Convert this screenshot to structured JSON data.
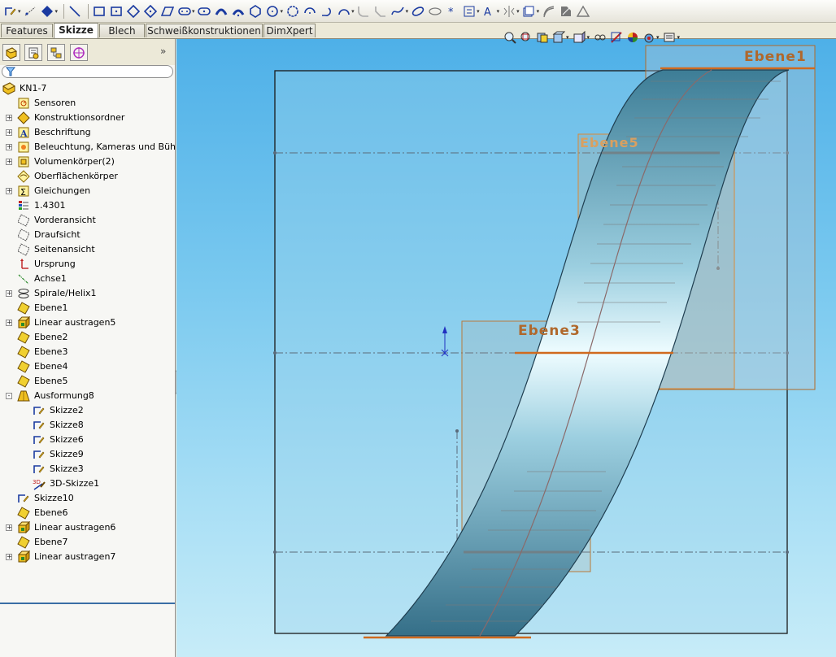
{
  "toolbar": {
    "icons": [
      "sketch-icon",
      "smart-dimension-icon",
      "relations-icon",
      "line-icon",
      "rectangle-icon",
      "center-rectangle-icon",
      "3point-rectangle-icon",
      "3point-center-rectangle-icon",
      "parallelogram-icon",
      "slot-icon",
      "centerpoint-slot-icon",
      "3point-arc-slot-icon",
      "centerpoint-arc-slot-icon",
      "polygon-icon",
      "circle-icon",
      "perimeter-circle-icon",
      "centerpoint-arc-icon",
      "tangent-arc-icon",
      "3point-arc-icon",
      "fillet-icon",
      "chamfer-icon",
      "spline-icon",
      "ellipse-icon",
      "partial-ellipse-icon",
      "point-icon",
      "text-icon",
      "trim-icon",
      "mirror-icon",
      "offset-icon",
      "linear-pattern-icon",
      "move-icon",
      "convert-entities-icon"
    ]
  },
  "tabs": [
    {
      "label": "Features",
      "active": false
    },
    {
      "label": "Skizze",
      "active": true
    },
    {
      "label": "Blech",
      "active": false
    },
    {
      "label": "Schweißkonstruktionen",
      "active": false
    },
    {
      "label": "DimXpert",
      "active": false
    }
  ],
  "panel": {
    "tabs": [
      "feature-manager-icon",
      "property-manager-icon",
      "configuration-manager-icon",
      "dimxpert-manager-icon"
    ],
    "collapse_label": "»",
    "tree": [
      {
        "label": "KN1-7",
        "icon": "part-icon",
        "indent": 0,
        "expander": ""
      },
      {
        "label": "Sensoren",
        "icon": "sensor-icon",
        "indent": 1,
        "expander": ""
      },
      {
        "label": "Konstruktionsordner",
        "icon": "design-binder-icon",
        "indent": 1,
        "expander": "+"
      },
      {
        "label": "Beschriftung",
        "icon": "annotation-icon",
        "indent": 1,
        "expander": "+"
      },
      {
        "label": "Beleuchtung, Kameras und Bühne",
        "icon": "lights-icon",
        "indent": 1,
        "expander": "+"
      },
      {
        "label": "Volumenkörper(2)",
        "icon": "solid-bodies-icon",
        "indent": 1,
        "expander": "+"
      },
      {
        "label": "Oberflächenkörper",
        "icon": "surface-bodies-icon",
        "indent": 1,
        "expander": ""
      },
      {
        "label": "Gleichungen",
        "icon": "equations-icon",
        "indent": 1,
        "expander": "+"
      },
      {
        "label": "1.4301",
        "icon": "material-icon",
        "indent": 1,
        "expander": ""
      },
      {
        "label": "Vorderansicht",
        "icon": "plane-icon",
        "indent": 1,
        "expander": ""
      },
      {
        "label": "Draufsicht",
        "icon": "plane-icon",
        "indent": 1,
        "expander": ""
      },
      {
        "label": "Seitenansicht",
        "icon": "plane-icon",
        "indent": 1,
        "expander": ""
      },
      {
        "label": "Ursprung",
        "icon": "origin-icon",
        "indent": 1,
        "expander": ""
      },
      {
        "label": "Achse1",
        "icon": "axis-icon",
        "indent": 1,
        "expander": ""
      },
      {
        "label": "Spirale/Helix1",
        "icon": "helix-icon",
        "indent": 1,
        "expander": "+"
      },
      {
        "label": "Ebene1",
        "icon": "plane-yellow-icon",
        "indent": 1,
        "expander": ""
      },
      {
        "label": "Linear austragen5",
        "icon": "extrude-icon",
        "indent": 1,
        "expander": "+"
      },
      {
        "label": "Ebene2",
        "icon": "plane-yellow-icon",
        "indent": 1,
        "expander": ""
      },
      {
        "label": "Ebene3",
        "icon": "plane-yellow-icon",
        "indent": 1,
        "expander": ""
      },
      {
        "label": "Ebene4",
        "icon": "plane-yellow-icon",
        "indent": 1,
        "expander": ""
      },
      {
        "label": "Ebene5",
        "icon": "plane-yellow-icon",
        "indent": 1,
        "expander": ""
      },
      {
        "label": "Ausformung8",
        "icon": "loft-icon",
        "indent": 1,
        "expander": "-"
      },
      {
        "label": "Skizze2",
        "icon": "sketch-icon",
        "indent": 2,
        "expander": ""
      },
      {
        "label": "Skizze8",
        "icon": "sketch-icon",
        "indent": 2,
        "expander": ""
      },
      {
        "label": "Skizze6",
        "icon": "sketch-icon",
        "indent": 2,
        "expander": ""
      },
      {
        "label": "Skizze9",
        "icon": "sketch-icon",
        "indent": 2,
        "expander": ""
      },
      {
        "label": "Skizze3",
        "icon": "sketch-icon",
        "indent": 2,
        "expander": ""
      },
      {
        "label": "3D-Skizze1",
        "icon": "3d-sketch-icon",
        "indent": 2,
        "expander": ""
      },
      {
        "label": "Skizze10",
        "icon": "sketch-icon",
        "indent": 1,
        "expander": ""
      },
      {
        "label": "Ebene6",
        "icon": "plane-yellow-icon",
        "indent": 1,
        "expander": ""
      },
      {
        "label": "Linear austragen6",
        "icon": "extrude-icon",
        "indent": 1,
        "expander": "+"
      },
      {
        "label": "Ebene7",
        "icon": "plane-yellow-icon",
        "indent": 1,
        "expander": ""
      },
      {
        "label": "Linear austragen7",
        "icon": "extrude-icon",
        "indent": 1,
        "expander": "+"
      }
    ]
  },
  "viewport": {
    "toolbar": [
      "zoom-to-fit-icon",
      "zoom-area-icon",
      "previous-view-icon",
      "section-view-icon",
      "view-orientation-icon",
      "display-style-icon",
      "hide-show-icon",
      "edit-appearance-icon",
      "apply-scene-icon",
      "view-settings-icon"
    ],
    "plane_labels": {
      "ebene1": "Ebene1",
      "ebene5": "Ebene5",
      "ebene3": "Ebene3"
    },
    "colors": {
      "plane_orange": "#c4702a",
      "body_blue": "#2f6f8f",
      "background_top": "#4eb0e8",
      "background_bottom": "#c7ecf8"
    }
  }
}
